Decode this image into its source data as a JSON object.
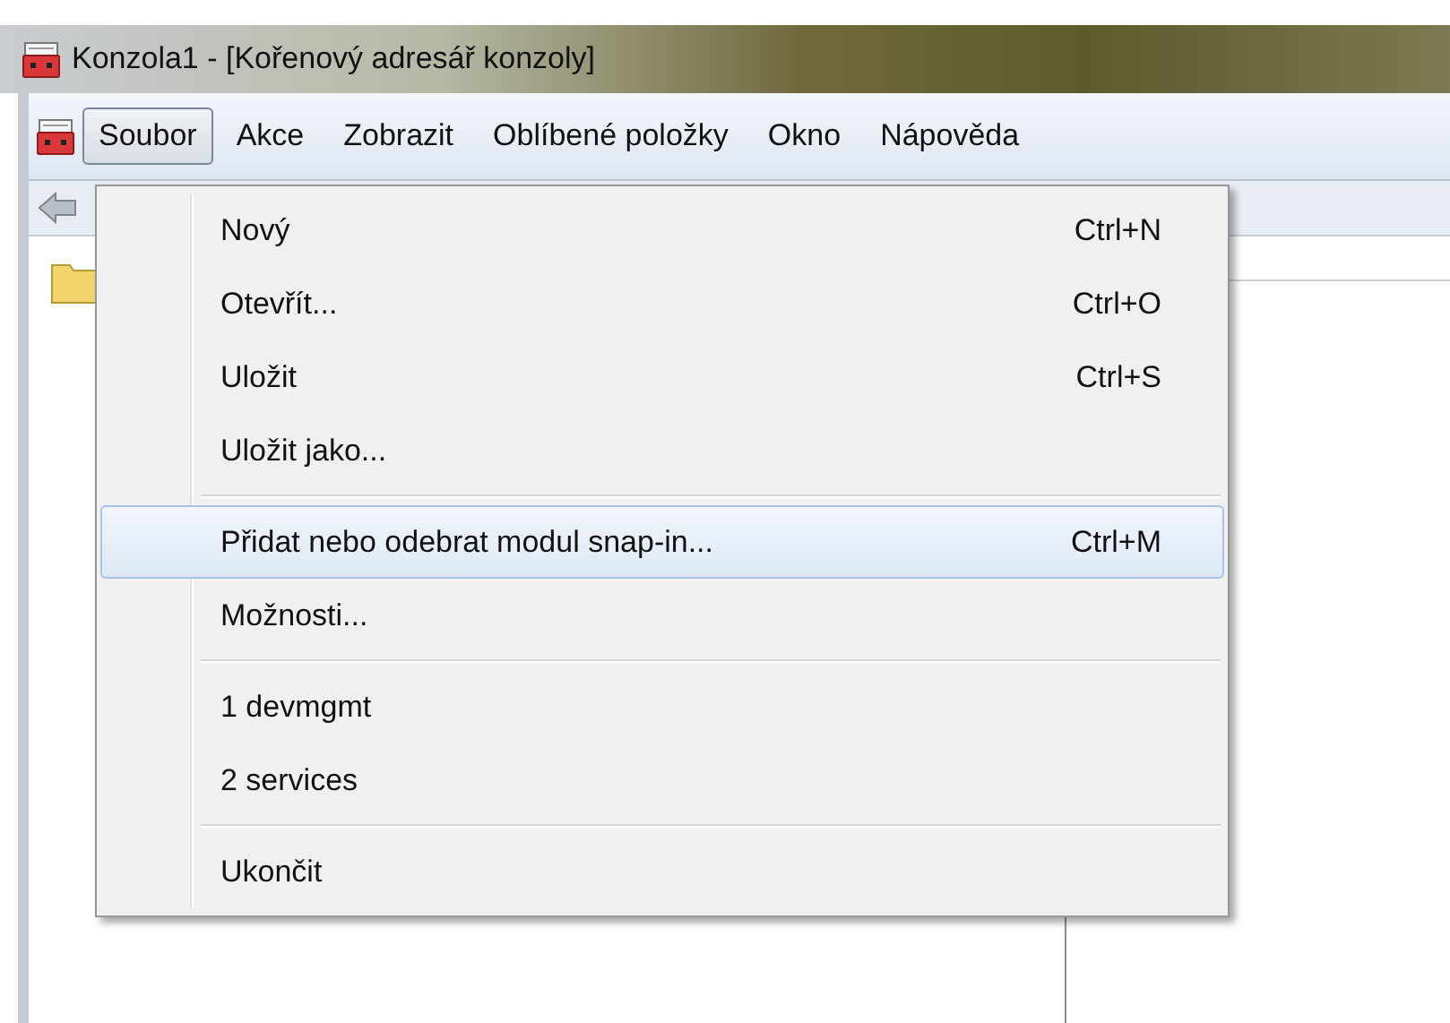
{
  "window": {
    "title": "Konzola1 - [Kořenový adresář konzoly]"
  },
  "menubar": [
    {
      "label": "Soubor",
      "selected": true
    },
    {
      "label": "Akce",
      "selected": false
    },
    {
      "label": "Zobrazit",
      "selected": false
    },
    {
      "label": "Oblíbené položky",
      "selected": false
    },
    {
      "label": "Okno",
      "selected": false
    },
    {
      "label": "Nápověda",
      "selected": false
    }
  ],
  "menu": [
    {
      "kind": "item",
      "label": "Nový",
      "shortcut": "Ctrl+N",
      "selected": false
    },
    {
      "kind": "item",
      "label": "Otevřít...",
      "shortcut": "Ctrl+O",
      "selected": false
    },
    {
      "kind": "item",
      "label": "Uložit",
      "shortcut": "Ctrl+S",
      "selected": false
    },
    {
      "kind": "item",
      "label": "Uložit jako...",
      "selected": false
    },
    {
      "kind": "separator"
    },
    {
      "kind": "item",
      "label": "Přidat nebo odebrat modul snap-in...",
      "shortcut": "Ctrl+M",
      "selected": true
    },
    {
      "kind": "item",
      "label": "Možnosti...",
      "selected": false
    },
    {
      "kind": "separator"
    },
    {
      "kind": "item",
      "label": "1 devmgmt",
      "selected": false
    },
    {
      "kind": "item",
      "label": "2 services",
      "selected": false
    },
    {
      "kind": "separator"
    },
    {
      "kind": "item",
      "label": "Ukončit",
      "selected": false
    }
  ]
}
